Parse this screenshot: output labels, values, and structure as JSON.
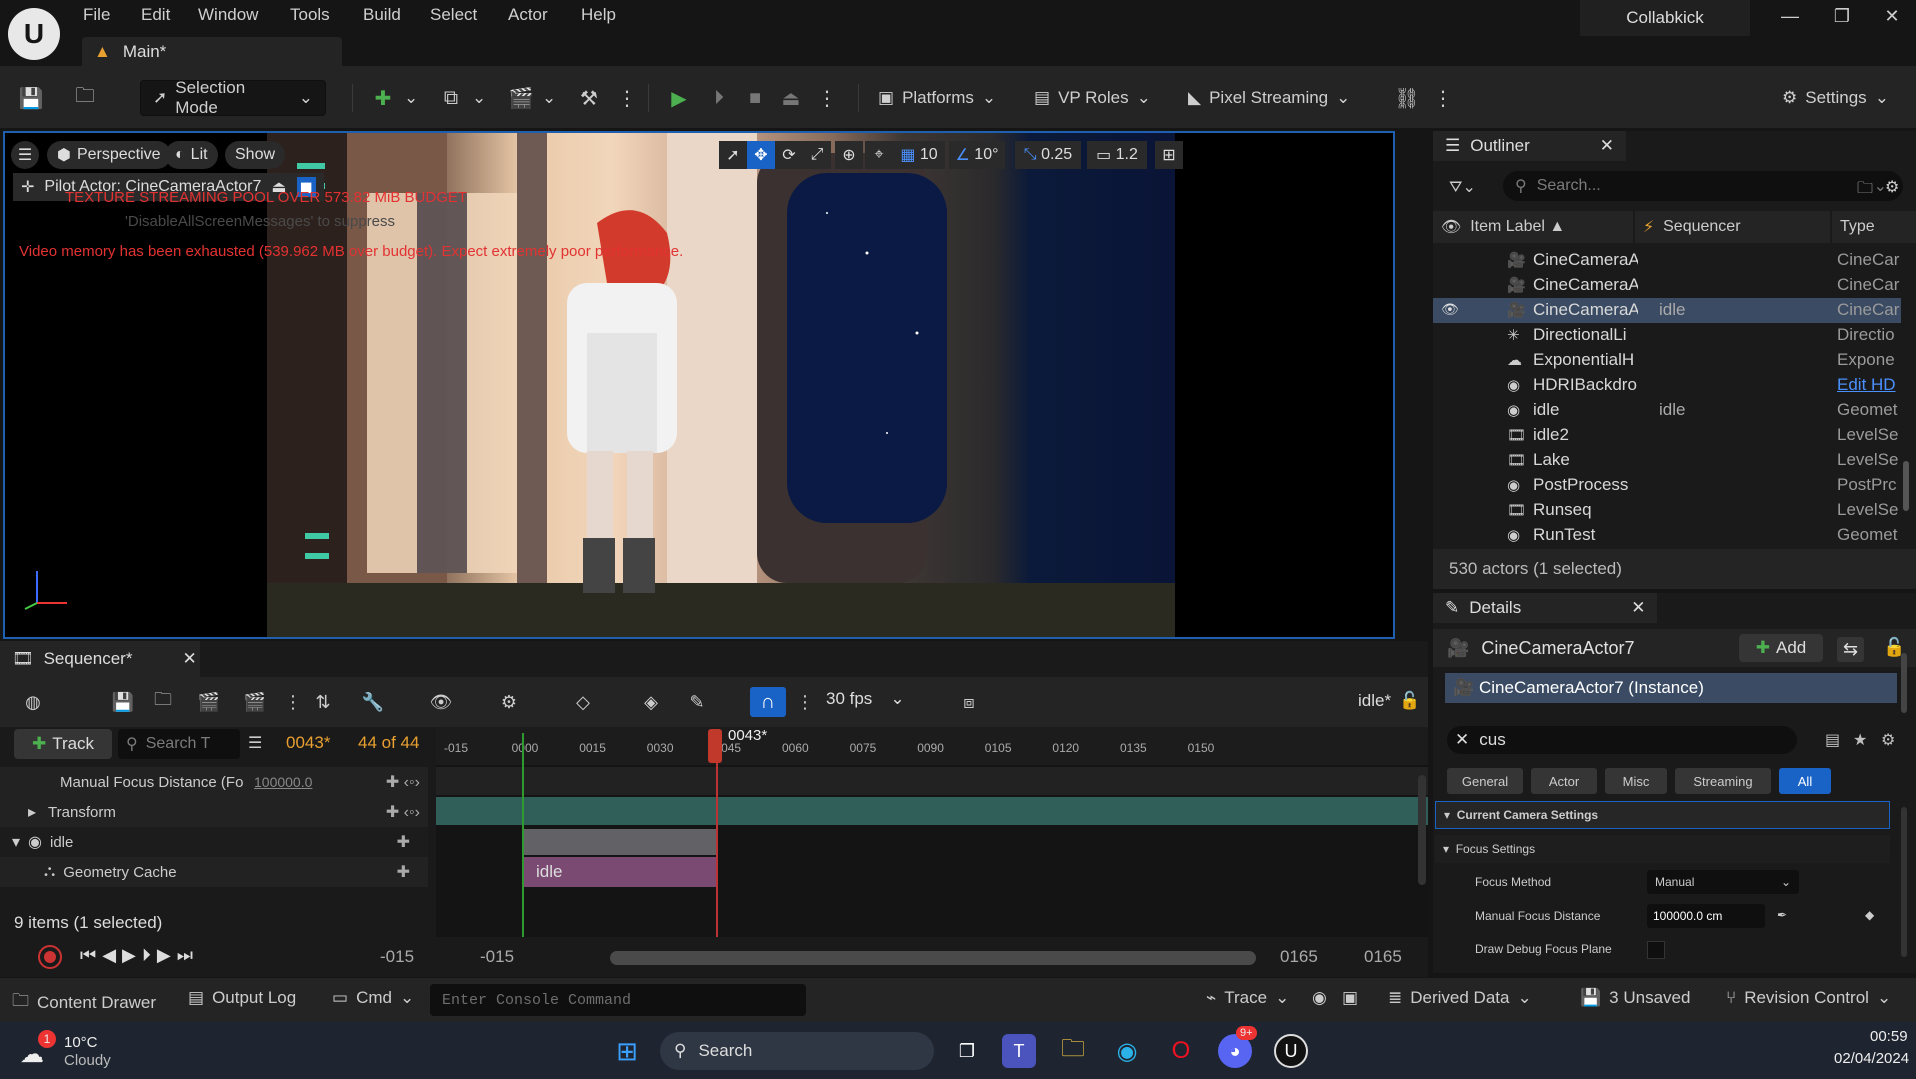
{
  "menu": [
    "File",
    "Edit",
    "Window",
    "Tools",
    "Build",
    "Select",
    "Actor",
    "Help"
  ],
  "doc_tab": "Main*",
  "app_name": "Collabkick",
  "toolbar": {
    "selection_mode": "Selection Mode",
    "platforms": "Platforms",
    "vp_roles": "VP Roles",
    "pixel_streaming": "Pixel Streaming",
    "settings": "Settings"
  },
  "viewport": {
    "perspective": "Perspective",
    "lit": "Lit",
    "show": "Show",
    "grid_value": "10",
    "angle_value": "10°",
    "scale_value": "0.25",
    "camera_speed": "1.2",
    "pilot_actor": "Pilot Actor: CineCameraActor7",
    "warn_texture": "TEXTURE STREAMING POOL OVER 573.82 MiB BUDGET",
    "warn_disable": "'DisableAllScreenMessages' to suppress",
    "warn_memory": "Video memory has been exhausted (539.962 MB over budget). Expect extremely poor performance."
  },
  "outliner": {
    "title": "Outliner",
    "search_placeholder": "Search...",
    "col_label": "Item Label",
    "col_sequencer": "Sequencer",
    "col_type": "Type",
    "rows": [
      {
        "label": "CineCameraA",
        "seq": "",
        "type": "CineCar"
      },
      {
        "label": "CineCameraA",
        "seq": "",
        "type": "CineCar"
      },
      {
        "label": "CineCameraA",
        "seq": "idle",
        "type": "CineCar"
      },
      {
        "label": "DirectionalLi",
        "seq": "",
        "type": "Directio"
      },
      {
        "label": "ExponentialH",
        "seq": "",
        "type": "Expone"
      },
      {
        "label": "HDRIBackdro",
        "seq": "",
        "type": "Edit HD"
      },
      {
        "label": "idle",
        "seq": "idle",
        "type": "Geomet"
      },
      {
        "label": "idle2",
        "seq": "",
        "type": "LevelSe"
      },
      {
        "label": "Lake",
        "seq": "",
        "type": "LevelSe"
      },
      {
        "label": "PostProcess",
        "seq": "",
        "type": "PostPrc"
      },
      {
        "label": "Runseq",
        "seq": "",
        "type": "LevelSe"
      },
      {
        "label": "RunTest",
        "seq": "",
        "type": "Geomet"
      }
    ],
    "footer": "530 actors (1 selected)"
  },
  "details": {
    "title": "Details",
    "actor": "CineCameraActor7",
    "add": "Add",
    "instance": "CineCameraActor7 (Instance)",
    "search_value": "cus",
    "filters": [
      "General",
      "Actor",
      "Misc",
      "Streaming",
      "All"
    ],
    "category": "Current Camera Settings",
    "subcategory": "Focus Settings",
    "focus_method_label": "Focus Method",
    "focus_method_value": "Manual",
    "manual_focus_label": "Manual Focus Distance",
    "manual_focus_value": "100000.0 cm",
    "debug_focus_label": "Draw Debug Focus Plane"
  },
  "sequencer": {
    "title": "Sequencer*",
    "fps": "30 fps",
    "seq_name": "idle*",
    "track": "Track",
    "search_placeholder": "Search T",
    "current_frame": "0043*",
    "frame_count": "44 of 44",
    "playhead_label": "0043*",
    "tree": [
      {
        "label": "Manual Focus Distance (Fo",
        "value": "100000.0"
      },
      {
        "label": "Transform",
        "value": ""
      },
      {
        "label": "idle",
        "value": ""
      },
      {
        "label": "Geometry Cache",
        "value": ""
      }
    ],
    "items_count": "9 items (1 selected)",
    "ticks": [
      "-015",
      "0000",
      "0015",
      "0030",
      "0045",
      "0060",
      "0075",
      "0090",
      "0105",
      "0120",
      "0135",
      "0150"
    ],
    "section_label": "idle",
    "range_start_a": "-015",
    "range_start_b": "-015",
    "range_end_a": "0165",
    "range_end_b": "0165"
  },
  "statusbar": {
    "content_drawer": "Content Drawer",
    "output_log": "Output Log",
    "cmd": "Cmd",
    "console_placeholder": "Enter Console Command",
    "trace": "Trace",
    "derived_data": "Derived Data",
    "unsaved": "3 Unsaved",
    "revision_control": "Revision Control"
  },
  "taskbar": {
    "temp": "10°C",
    "weather": "Cloudy",
    "weather_badge": "1",
    "search": "Search",
    "discord_badge": "9+",
    "time": "00:59",
    "date": "02/04/2024"
  },
  "colors": {
    "accent": "#1a63c6",
    "selected_row": "#3a4b63",
    "warning": "#e33232",
    "section": "#7b4a73",
    "track_green": "#2f5f58"
  }
}
